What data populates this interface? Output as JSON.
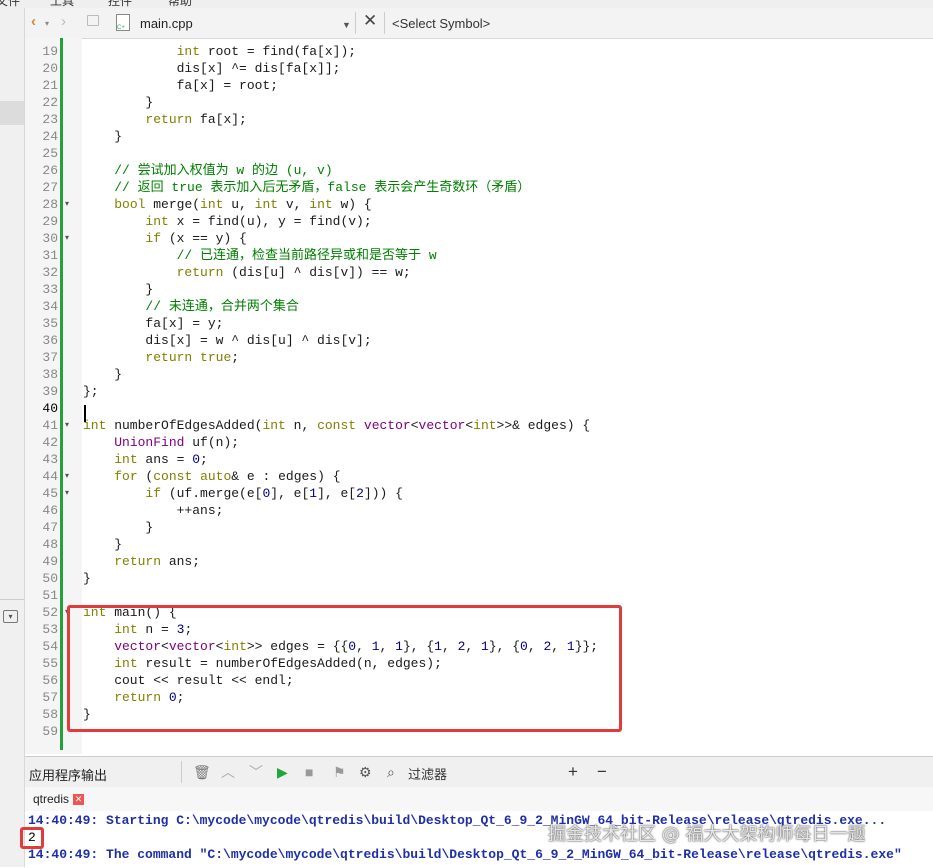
{
  "menu": {
    "items": [
      "文件",
      "工具",
      "控件",
      "帮助"
    ]
  },
  "toolbar": {
    "back_icon": "chevron-left-icon",
    "forward_icon": "chevron-right-icon",
    "file_name": "main.cpp",
    "symbol_placeholder": "<Select Symbol>"
  },
  "editor": {
    "current_line": "40",
    "lines": [
      {
        "n": "19",
        "t": "            int root = find(fa[x]);"
      },
      {
        "n": "20",
        "t": "            dis[x] ^= dis[fa[x]];"
      },
      {
        "n": "21",
        "t": "            fa[x] = root;"
      },
      {
        "n": "22",
        "t": "        }"
      },
      {
        "n": "23",
        "t": "        return fa[x];"
      },
      {
        "n": "24",
        "t": "    }"
      },
      {
        "n": "25",
        "t": ""
      },
      {
        "n": "26",
        "t": "    // 尝试加入权值为 w 的边 (u, v)"
      },
      {
        "n": "27",
        "t": "    // 返回 true 表示加入后无矛盾，false 表示会产生奇数环（矛盾）"
      },
      {
        "n": "28",
        "t": "    bool merge(int u, int v, int w) {"
      },
      {
        "n": "29",
        "t": "        int x = find(u), y = find(v);"
      },
      {
        "n": "30",
        "t": "        if (x == y) {"
      },
      {
        "n": "31",
        "t": "            // 已连通，检查当前路径异或和是否等于 w"
      },
      {
        "n": "32",
        "t": "            return (dis[u] ^ dis[v]) == w;"
      },
      {
        "n": "33",
        "t": "        }"
      },
      {
        "n": "34",
        "t": "        // 未连通，合并两个集合"
      },
      {
        "n": "35",
        "t": "        fa[x] = y;"
      },
      {
        "n": "36",
        "t": "        dis[x] = w ^ dis[u] ^ dis[v];"
      },
      {
        "n": "37",
        "t": "        return true;"
      },
      {
        "n": "38",
        "t": "    }"
      },
      {
        "n": "39",
        "t": "};"
      },
      {
        "n": "40",
        "t": ""
      },
      {
        "n": "41",
        "t": "int numberOfEdgesAdded(int n, const vector<vector<int>>& edges) {"
      },
      {
        "n": "42",
        "t": "    UnionFind uf(n);"
      },
      {
        "n": "43",
        "t": "    int ans = 0;"
      },
      {
        "n": "44",
        "t": "    for (const auto& e : edges) {"
      },
      {
        "n": "45",
        "t": "        if (uf.merge(e[0], e[1], e[2])) {"
      },
      {
        "n": "46",
        "t": "            ++ans;"
      },
      {
        "n": "47",
        "t": "        }"
      },
      {
        "n": "48",
        "t": "    }"
      },
      {
        "n": "49",
        "t": "    return ans;"
      },
      {
        "n": "50",
        "t": "}"
      },
      {
        "n": "51",
        "t": ""
      },
      {
        "n": "52",
        "t": "int main() {"
      },
      {
        "n": "53",
        "t": "    int n = 3;"
      },
      {
        "n": "54",
        "t": "    vector<vector<int>> edges = {{0, 1, 1}, {1, 2, 1}, {0, 2, 1}};"
      },
      {
        "n": "55",
        "t": "    int result = numberOfEdgesAdded(n, edges);"
      },
      {
        "n": "56",
        "t": "    cout << result << endl;"
      },
      {
        "n": "57",
        "t": "    return 0;"
      },
      {
        "n": "58",
        "t": "}"
      },
      {
        "n": "59",
        "t": ""
      }
    ],
    "fold_markers": [
      "28",
      "30",
      "41",
      "44",
      "45",
      "52"
    ]
  },
  "output": {
    "title": "应用程序输出",
    "filter_label": "过滤器",
    "tab_label": "qtredis",
    "lines": [
      "14:40:49: Starting C:\\mycode\\mycode\\qtredis\\build\\Desktop_Qt_6_9_2_MinGW_64_bit-Release\\release\\qtredis.exe...",
      "2",
      "14:40:49: The command \"C:\\mycode\\mycode\\qtredis\\build\\Desktop_Qt_6_9_2_MinGW_64_bit-Release\\release\\qtredis.exe\""
    ]
  },
  "watermark": "掘金技术社区 @ 福大大架构师每日一题",
  "colors": {
    "highlight": "#e23b3b",
    "change_bar": "#22a33a",
    "output_text": "#1f2fa6"
  }
}
